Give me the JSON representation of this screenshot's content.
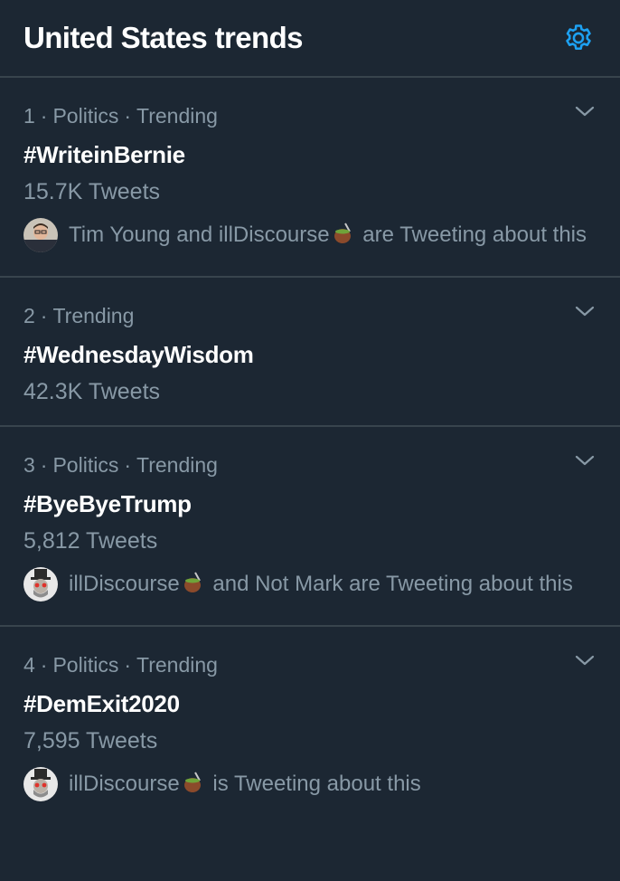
{
  "header": {
    "title": "United States trends",
    "settings_icon": "gear-icon",
    "accent": "#1da1f2"
  },
  "colors": {
    "background": "#1c2733",
    "border": "#38444d",
    "secondary_text": "#8899a6"
  },
  "trends": [
    {
      "rank": "1",
      "category": "Politics",
      "status": "Trending",
      "hashtag": "#WriteinBernie",
      "count": "15.7K Tweets",
      "context_names": "Tim Young and illDiscourse",
      "context_suffix": "are Tweeting about this"
    },
    {
      "rank": "2",
      "status": "Trending",
      "hashtag": "#WednesdayWisdom",
      "count": "42.3K Tweets"
    },
    {
      "rank": "3",
      "category": "Politics",
      "status": "Trending",
      "hashtag": "#ByeByeTrump",
      "count": "5,812 Tweets",
      "context_names": "illDiscourse",
      "context_suffix": "and Not Mark are Tweeting about this"
    },
    {
      "rank": "4",
      "category": "Politics",
      "status": "Trending",
      "hashtag": "#DemExit2020",
      "count": "7,595 Tweets",
      "context_names": "illDiscourse",
      "context_suffix": "is Tweeting about this"
    }
  ],
  "separator": "·"
}
